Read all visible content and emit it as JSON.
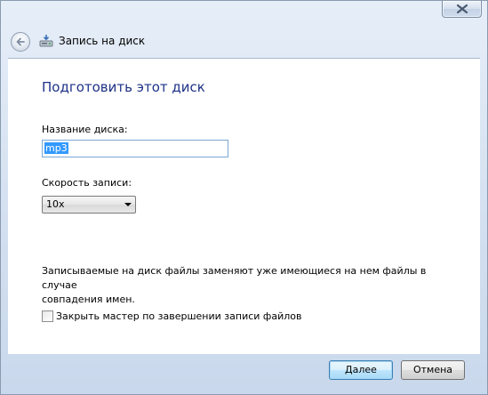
{
  "window": {
    "title": "Запись на диск"
  },
  "titlebar": {
    "close_icon": "close-icon",
    "back_icon": "back-arrow-icon",
    "wizard_icon": "disc-burner-icon"
  },
  "page": {
    "heading": "Подготовить этот диск",
    "disc_name_label": "Название диска:",
    "disc_name_value": "mp3",
    "speed_label": "Скорость записи:",
    "speed_value": "10x",
    "info_line1": "Записываемые на диск файлы заменяют уже имеющиеся на нем файлы в случае",
    "info_line2": "совпадения имен.",
    "close_checkbox_label": "Закрыть мастер по завершении записи файлов",
    "close_checkbox_checked": false
  },
  "footer": {
    "next_label": "Далее",
    "cancel_label": "Отмена"
  },
  "colors": {
    "heading": "#1e3287",
    "selection": "#3399ff",
    "default_button_border": "#3c7fb1"
  }
}
